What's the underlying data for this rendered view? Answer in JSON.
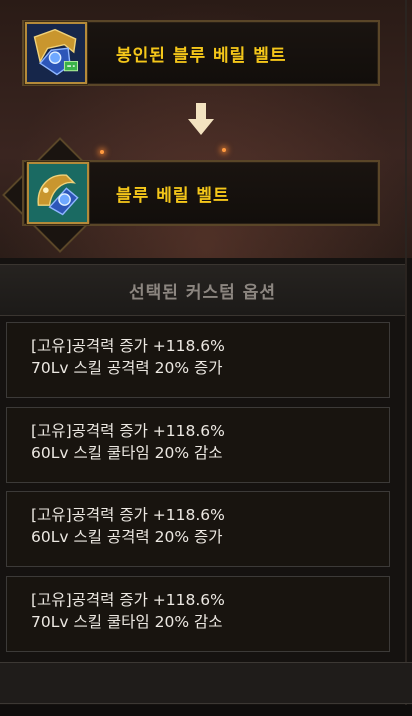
{
  "sealed_item": {
    "name": "봉인된 블루 베릴 벨트",
    "icon": "belt-sealed-icon"
  },
  "arrow": {
    "icon": "arrow-down-icon"
  },
  "result_item": {
    "name": "블루 베릴 벨트",
    "icon": "belt-icon"
  },
  "options_panel": {
    "title": "선택된 커스텀 옵션",
    "options": [
      {
        "line1": "[고유]공격력 증가 +118.6%",
        "line2": "70Lv 스킬 공격력 20% 증가"
      },
      {
        "line1": "[고유]공격력 증가 +118.6%",
        "line2": "60Lv 스킬 쿨타임 20% 감소"
      },
      {
        "line1": "[고유]공격력 증가 +118.6%",
        "line2": "60Lv 스킬 공격력 20% 증가"
      },
      {
        "line1": "[고유]공격력 증가 +118.6%",
        "line2": "70Lv 스킬 쿨타임 20% 감소"
      }
    ]
  },
  "colors": {
    "item_name": "#f5c71a",
    "option_text": "#ece8e2",
    "header_text": "#8c8680"
  }
}
